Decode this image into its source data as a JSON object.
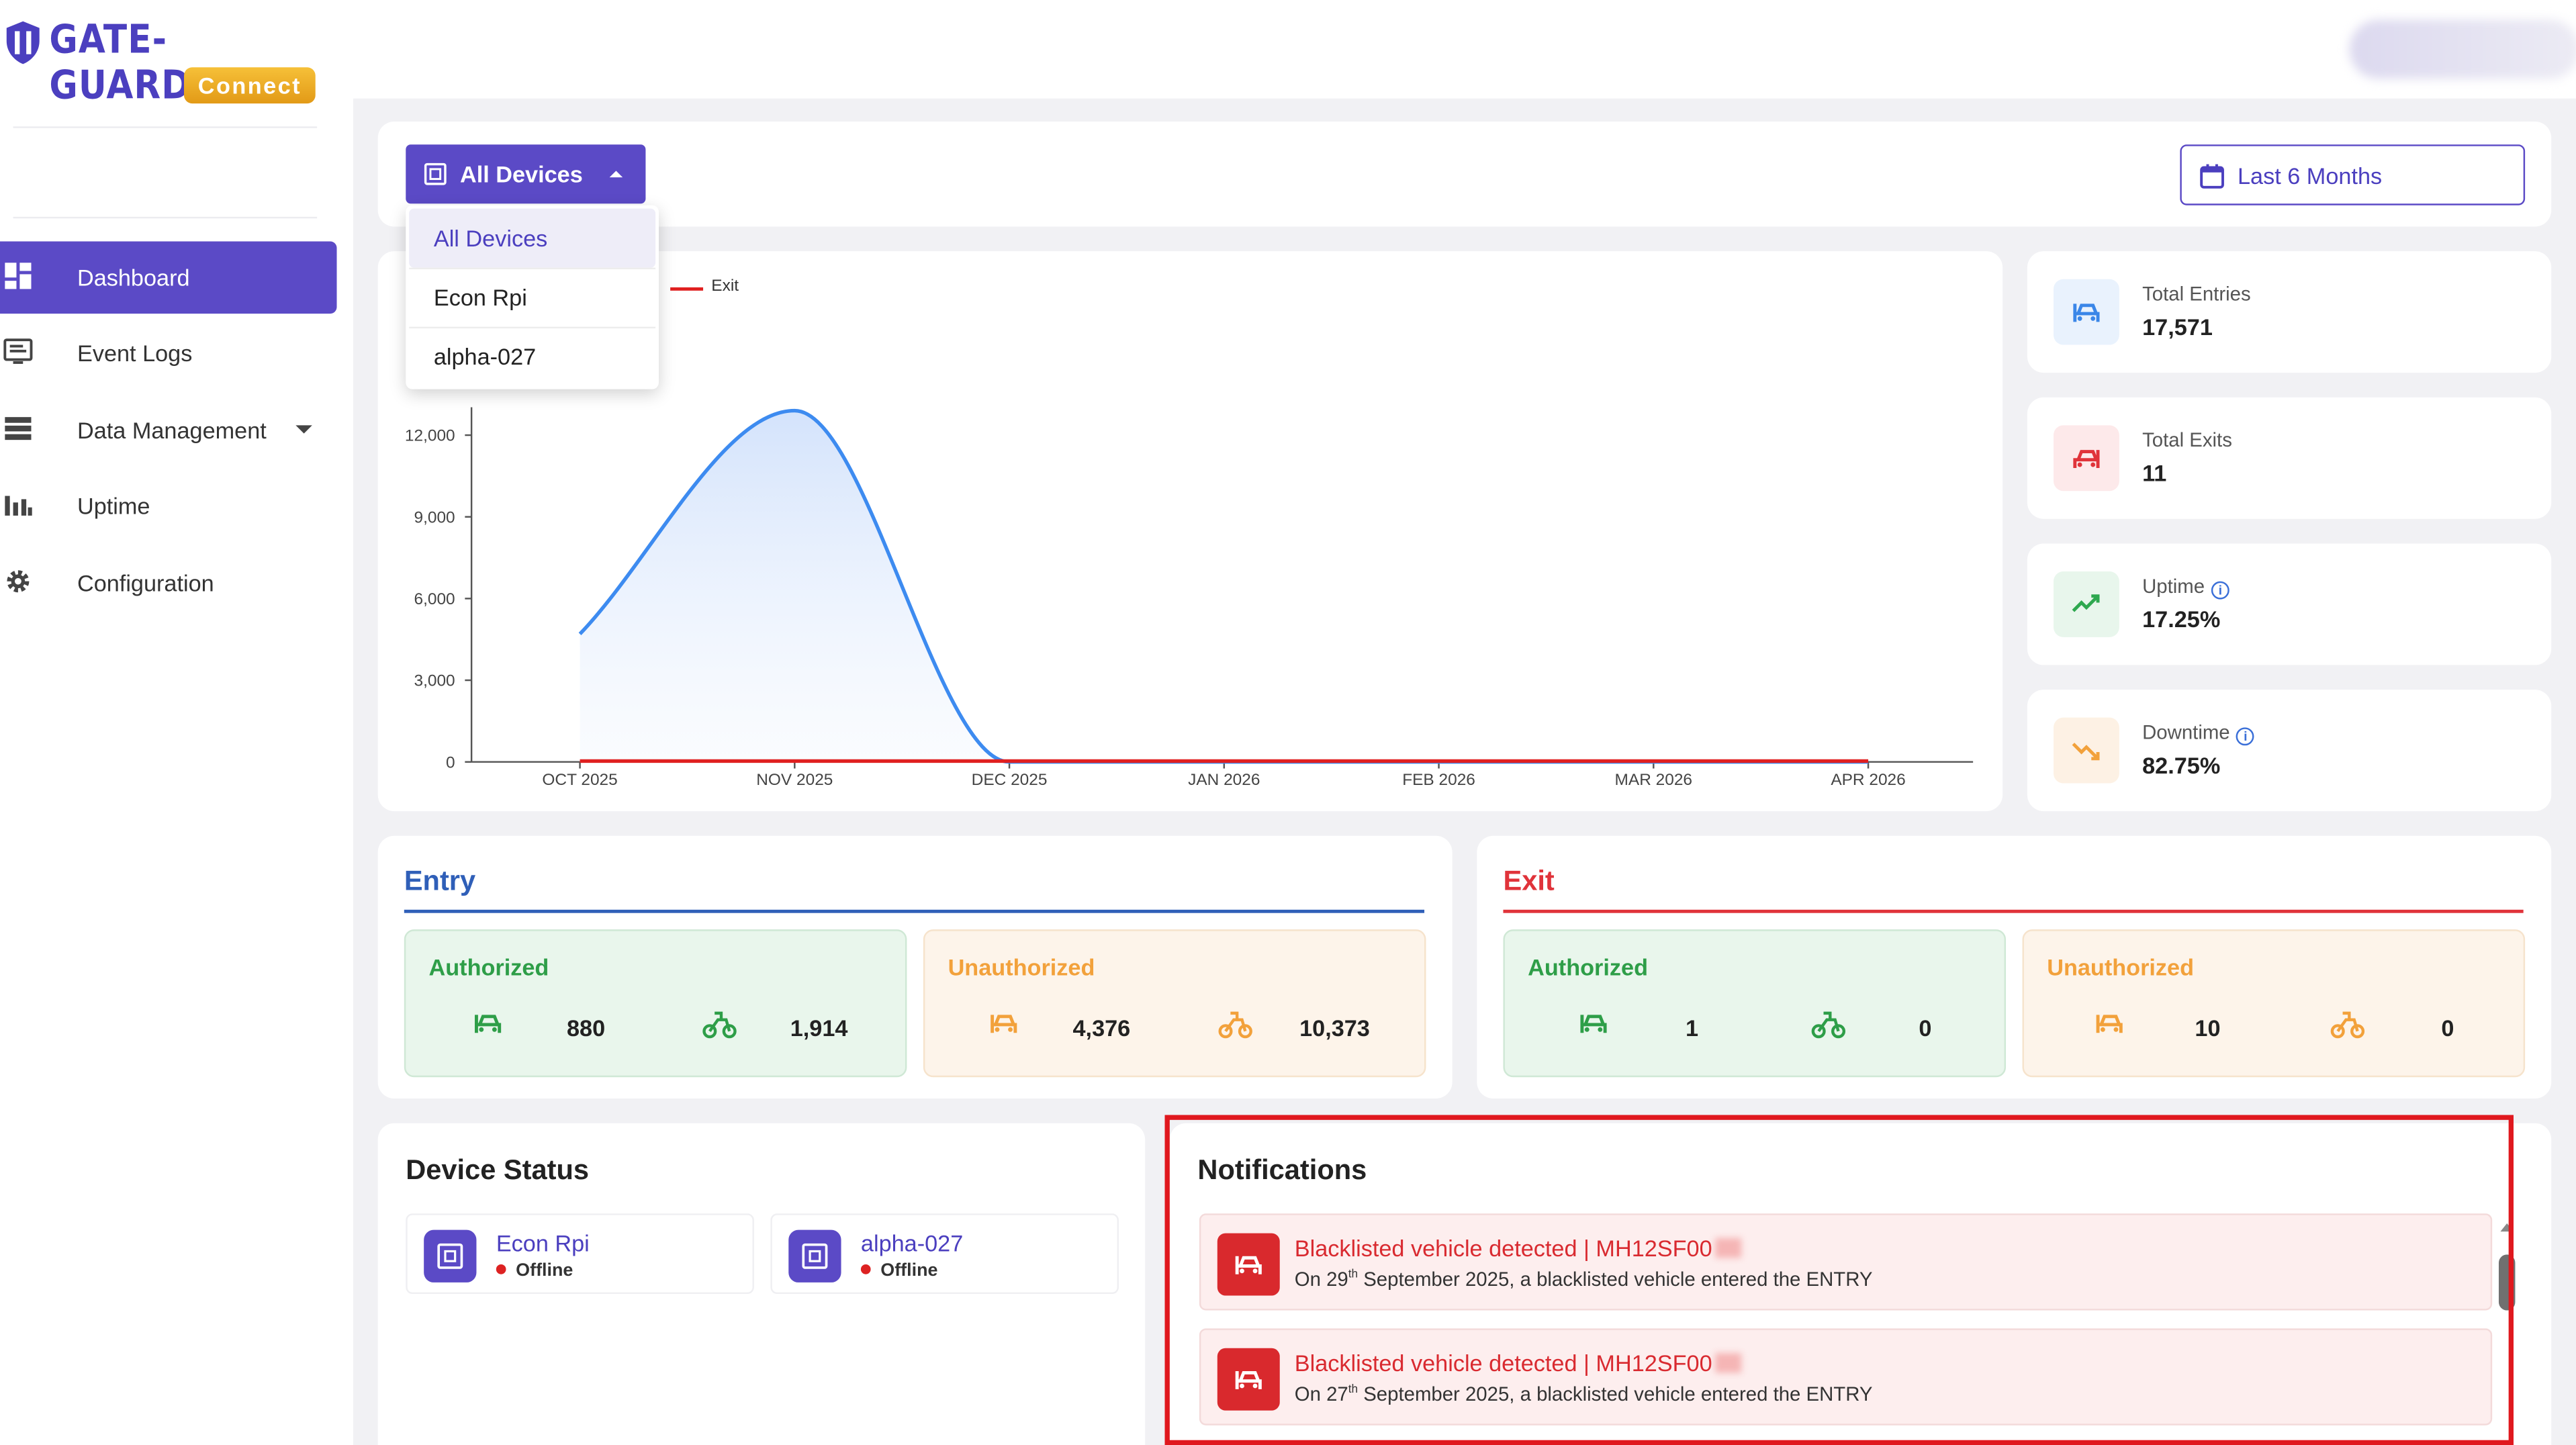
{
  "brand": {
    "name": "GATE-GUARD",
    "sub": "Connect"
  },
  "sidebar": {
    "items": [
      {
        "label": "Dashboard",
        "icon": "dashboard-icon",
        "active": true
      },
      {
        "label": "Event Logs",
        "icon": "event-logs-icon"
      },
      {
        "label": "Data Management",
        "icon": "data-management-icon",
        "has_caret": true
      },
      {
        "label": "Uptime",
        "icon": "uptime-icon"
      },
      {
        "label": "Configuration",
        "icon": "gear-icon"
      }
    ]
  },
  "filters": {
    "device_button": "All Devices",
    "range_button": "Last 6 Months",
    "dropdown_options": [
      "All Devices",
      "Econ Rpi",
      "alpha-027"
    ]
  },
  "chart_data": {
    "type": "area",
    "legend_visible": [
      "Exit"
    ],
    "categories": [
      "OCT 2025",
      "NOV 2025",
      "DEC 2025",
      "JAN 2026",
      "FEB 2026",
      "MAR 2026",
      "APR 2026"
    ],
    "y_ticks": [
      "0",
      "3,000",
      "6,000",
      "9,000",
      "12,000"
    ],
    "ylim": [
      0,
      12000
    ],
    "series": [
      {
        "values": [
          4700,
          12900,
          0,
          0,
          0,
          0,
          0
        ],
        "color": "#3d8bf0"
      },
      {
        "name": "Exit",
        "values": [
          0,
          0,
          0,
          0,
          0,
          0,
          0
        ],
        "color": "#e02020"
      }
    ]
  },
  "stats": [
    {
      "title": "Total Entries",
      "value": "17,571",
      "icon": "car-entry-icon",
      "bg": "#e9f2fd",
      "fg": "#3a86e8"
    },
    {
      "title": "Total Exits",
      "value": "11",
      "icon": "car-exit-icon",
      "bg": "#fde9ea",
      "fg": "#e0333a"
    },
    {
      "title": "Uptime",
      "value": "17.25%",
      "icon": "trend-up-icon",
      "bg": "#e8f6ec",
      "fg": "#2ea84f",
      "info": true
    },
    {
      "title": "Downtime",
      "value": "82.75%",
      "icon": "trend-down-icon",
      "bg": "#fdf1e4",
      "fg": "#f2a13b",
      "info": true
    }
  ],
  "entry": {
    "title": "Entry",
    "authorized": {
      "label": "Authorized",
      "car": "880",
      "bike": "1,914"
    },
    "unauthorized": {
      "label": "Unauthorized",
      "car": "4,376",
      "bike": "10,373"
    }
  },
  "exit": {
    "title": "Exit",
    "authorized": {
      "label": "Authorized",
      "car": "1",
      "bike": "0"
    },
    "unauthorized": {
      "label": "Unauthorized",
      "car": "10",
      "bike": "0"
    }
  },
  "device_status": {
    "title": "Device Status",
    "devices": [
      {
        "name": "Econ Rpi",
        "status": "Offline"
      },
      {
        "name": "alpha-027",
        "status": "Offline"
      }
    ]
  },
  "notifications": {
    "title": "Notifications",
    "items": [
      {
        "title": "Blacklisted vehicle detected | MH12SF00",
        "pre": "On 29",
        "sup": "th",
        "post": " September 2025, a blacklisted vehicle entered the ENTRY"
      },
      {
        "title": "Blacklisted vehicle detected | MH12SF00",
        "pre": "On 27",
        "sup": "th",
        "post": " September 2025, a blacklisted vehicle entered the ENTRY"
      }
    ]
  },
  "colors": {
    "accent": "#5b4ac6",
    "entry_blue": "#2f5fb8",
    "exit_red": "#e0333a",
    "authorized_green": "#2e9e48",
    "unauthorized_orange": "#f2a13b"
  }
}
